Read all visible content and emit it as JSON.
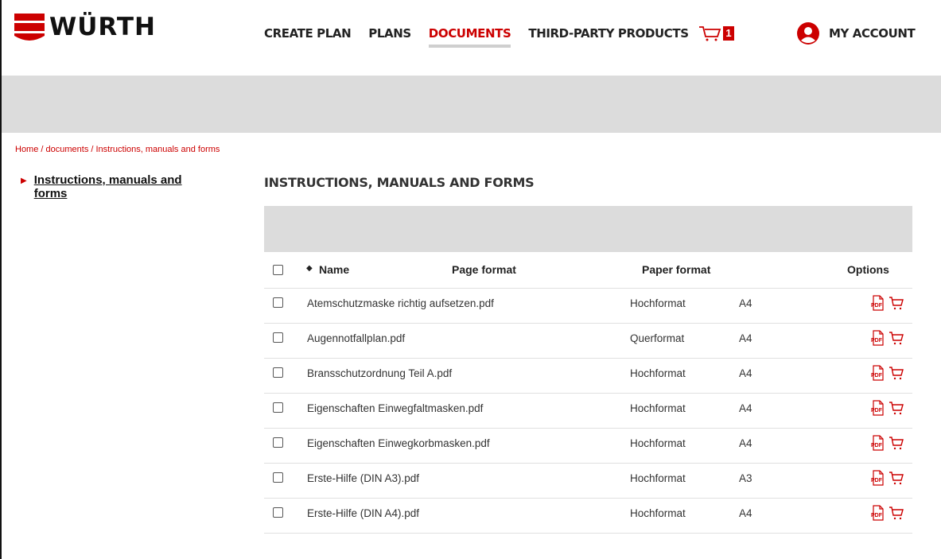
{
  "brand": {
    "name": "WÜRTH",
    "accent": "#cc0000"
  },
  "nav": {
    "items": [
      "CREATE PLAN",
      "PLANS",
      "DOCUMENTS",
      "THIRD-PARTY PRODUCTS"
    ],
    "active": "DOCUMENTS",
    "cart_count": "1",
    "account_label": "MY ACCOUNT"
  },
  "breadcrumb": {
    "home": "Home",
    "documents": "documents",
    "current": "Instructions, manuals and forms",
    "separator": " / "
  },
  "sidebar": {
    "items": [
      {
        "label": "Instructions, manuals and forms",
        "line1": "Instructions, manuals and",
        "line2": "forms"
      }
    ]
  },
  "page": {
    "title": "INSTRUCTIONS, MANUALS AND FORMS"
  },
  "table": {
    "headers": {
      "name": "Name",
      "page_format": "Page format",
      "paper_format": "Paper format",
      "options": "Options"
    },
    "rows": [
      {
        "name": "Atemschutzmaske richtig aufsetzen.pdf",
        "page_format": "Hochformat",
        "paper_format": "A4"
      },
      {
        "name": "Augennotfallplan.pdf",
        "page_format": "Querformat",
        "paper_format": "A4"
      },
      {
        "name": "Bransschutzordnung Teil A.pdf",
        "page_format": "Hochformat",
        "paper_format": "A4"
      },
      {
        "name": "Eigenschaften Einwegfaltmasken.pdf",
        "page_format": "Hochformat",
        "paper_format": "A4"
      },
      {
        "name": "Eigenschaften Einwegkorbmasken.pdf",
        "page_format": "Hochformat",
        "paper_format": "A4"
      },
      {
        "name": "Erste-Hilfe (DIN A3).pdf",
        "page_format": "Hochformat",
        "paper_format": "A3"
      },
      {
        "name": "Erste-Hilfe (DIN A4).pdf",
        "page_format": "Hochformat",
        "paper_format": "A4"
      }
    ],
    "icons": {
      "pdf": "pdf-icon",
      "cart": "add-to-cart-icon"
    }
  }
}
